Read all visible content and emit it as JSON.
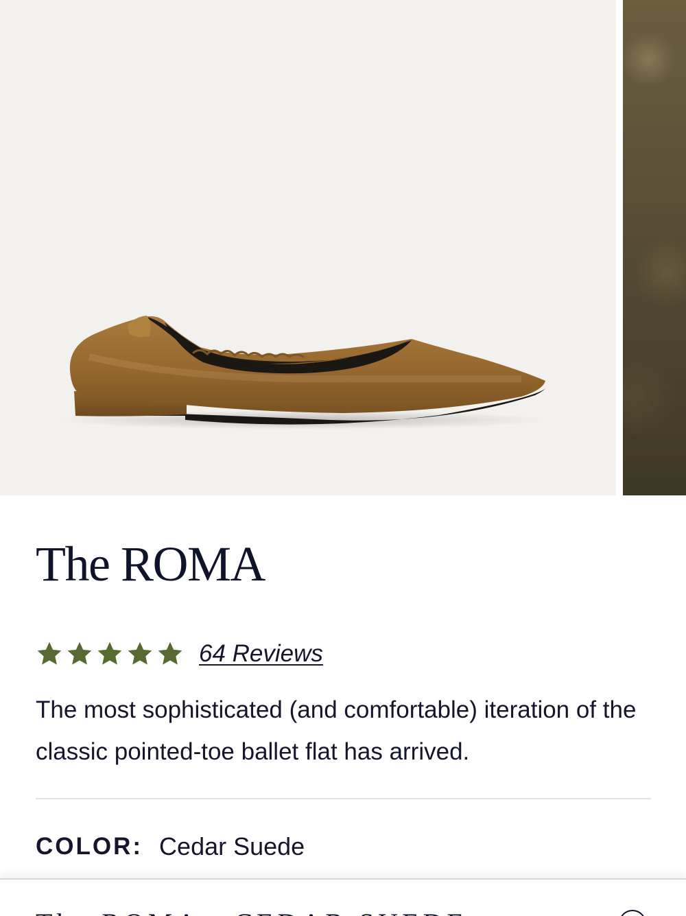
{
  "product": {
    "title": "The ROMA",
    "rating": {
      "stars": 5,
      "max": 5,
      "reviews_label": "64 Reviews",
      "star_color": "#566a32"
    },
    "description": "The most sophisticated (and comfortable) iteration of the classic pointed-toe ballet flat has arrived.",
    "color": {
      "label": "COLOR:",
      "value": "Cedar Suede"
    }
  },
  "sticky_bar": {
    "title": "The ROMA - CEDAR SUEDE"
  },
  "colors": {
    "text": "#15152b",
    "image_background": "#f3f1ed",
    "suede": "#9c6e33"
  },
  "icons": {
    "rating": "star-icon",
    "sticky_toggle": "chevron-circle-icon"
  }
}
